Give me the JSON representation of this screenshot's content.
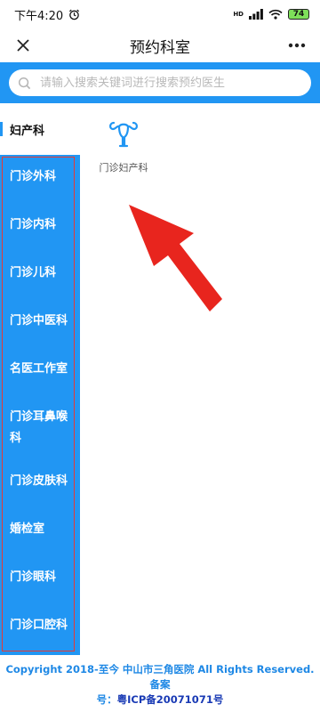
{
  "status_bar": {
    "time": "下午4:20",
    "hd_label": "HD",
    "battery": "74"
  },
  "header": {
    "title": "预约科室"
  },
  "search": {
    "placeholder": "请输入搜索关键词进行搜索预约医生"
  },
  "sidebar": {
    "active": "妇产科",
    "items": [
      {
        "label": "门诊外科"
      },
      {
        "label": "门诊内科"
      },
      {
        "label": "门诊儿科"
      },
      {
        "label": "门诊中医科"
      },
      {
        "label": "名医工作室"
      },
      {
        "label": "门诊耳鼻喉科"
      },
      {
        "label": "门诊皮肤科"
      },
      {
        "label": "婚检室"
      },
      {
        "label": "门诊眼科"
      },
      {
        "label": "门诊口腔科"
      }
    ]
  },
  "departments": [
    {
      "label": "门诊妇产科",
      "icon": "uterus-icon"
    }
  ],
  "footer": {
    "line1": "Copyright 2018-至今 中山市三角医院 All Rights Reserved. 备案",
    "line2_prefix": "号：",
    "icp": "粤ICP备20071071号"
  },
  "colors": {
    "primary": "#2196f3",
    "highlight": "#e53935",
    "icp": "#1a3bb5"
  }
}
